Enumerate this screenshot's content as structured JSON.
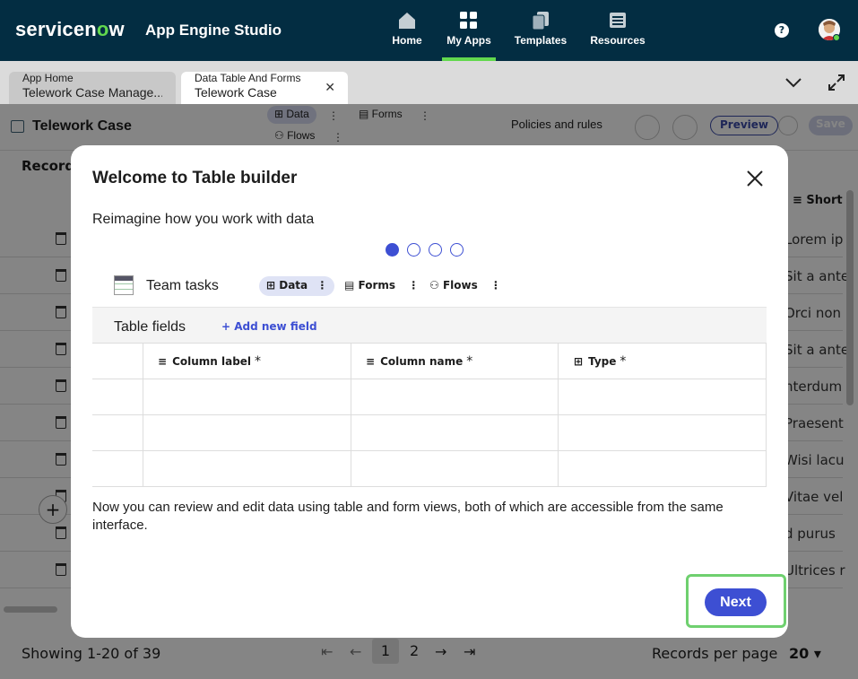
{
  "topnav": {
    "brand_left": "servicen",
    "brand_o": "o",
    "brand_right": "w",
    "app_title": "App Engine Studio",
    "items": [
      {
        "label": "Home",
        "icon": "home-icon"
      },
      {
        "label": "My Apps",
        "icon": "grid-icon",
        "active": true
      },
      {
        "label": "Templates",
        "icon": "templates-icon"
      },
      {
        "label": "Resources",
        "icon": "resources-icon"
      }
    ],
    "help": "?"
  },
  "tabs": [
    {
      "line1": "App Home",
      "line2": "Telework Case Manage..."
    },
    {
      "line1": "Data Table And Forms",
      "line2": "Telework Case",
      "close": "✕"
    }
  ],
  "page": {
    "title": "Telework Case",
    "pills": {
      "data": "Data",
      "forms": "Forms",
      "flows": "Flows"
    },
    "policies": "Policies and rules",
    "preview": "Preview",
    "save": "Save",
    "records_label": "Record",
    "short_header": "Short",
    "rows": [
      "Lorem ip",
      "Sit a ante",
      "Orci non",
      "Sit a ante",
      "nterdum",
      "Praesent",
      "Wisi lacu",
      "Vitae vel",
      "d purus",
      "Ultrices r"
    ],
    "footer": {
      "showing": "Showing 1-20 of 39",
      "pages": [
        "1",
        "2"
      ],
      "records_per_page": "Records per page",
      "rpp_value": "20"
    }
  },
  "modal": {
    "title": "Welcome to Table builder",
    "subtitle": "Reimagine how you work with data",
    "steps_total": 4,
    "step_current": 1,
    "preview": {
      "table_name": "Team tasks",
      "pills": {
        "data": "Data",
        "forms": "Forms",
        "flows": "Flows"
      },
      "fields_label": "Table fields",
      "add_field": "+ Add new field",
      "columns": [
        {
          "label": "Column label",
          "required": "*"
        },
        {
          "label": "Column name",
          "required": "*"
        },
        {
          "label": "Type",
          "required": "*"
        }
      ]
    },
    "description": "Now you can review and edit data using table and form views, both of which are accessible from the same interface.",
    "next": "Next",
    "accent": "#3d4fd3",
    "highlight": "#6fd06f"
  }
}
